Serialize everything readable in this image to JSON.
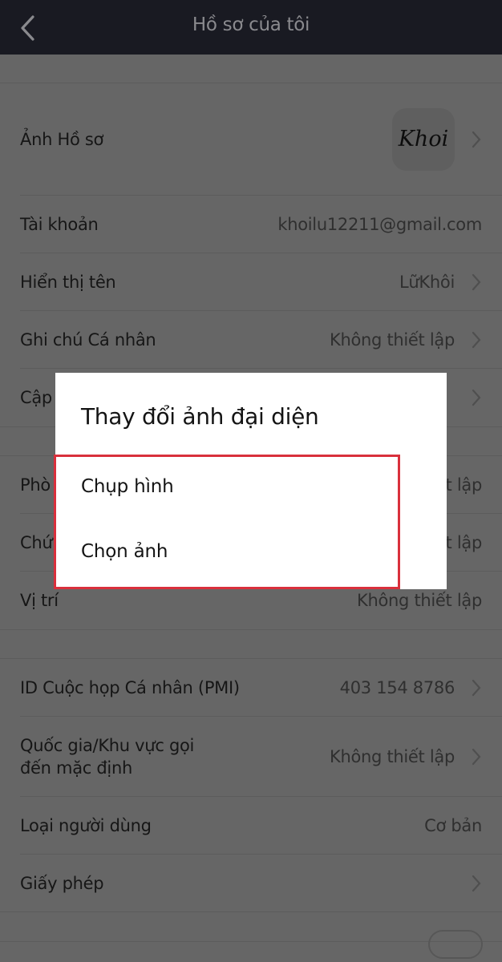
{
  "header": {
    "back_icon": "chevron-left-icon",
    "title": "Hồ sơ của tôi"
  },
  "sections": [
    {
      "rows": [
        {
          "label": "Ảnh Hồ sơ",
          "avatar_text": "Khoi",
          "chevron": true
        },
        {
          "label": "Tài khoản",
          "value": "khoilu12211@gmail.com",
          "chevron": false
        },
        {
          "label": "Hiển thị tên",
          "value": "LữKhôi",
          "chevron": true
        },
        {
          "label": "Ghi chú Cá nhân",
          "value": "Không thiết lập",
          "chevron": true
        },
        {
          "label": "Cập",
          "value": "",
          "chevron": true
        }
      ]
    },
    {
      "rows": [
        {
          "label": "Phò",
          "value": "t lập",
          "chevron": false
        },
        {
          "label": "Chứ",
          "value": "t lập",
          "chevron": false
        },
        {
          "label": "Vị trí",
          "value": "Không thiết lập",
          "chevron": false
        }
      ]
    },
    {
      "rows": [
        {
          "label": "ID Cuộc họp Cá nhân (PMI)",
          "value": "403 154 8786",
          "chevron": true
        },
        {
          "label_line1": "Quốc gia/Khu vực gọi",
          "label_line2": "đến mặc định",
          "value": "Không thiết lập",
          "chevron": true
        },
        {
          "label": "Loại người dùng",
          "value": "Cơ bản",
          "chevron": false
        },
        {
          "label": "Giấy phép",
          "value": "",
          "chevron": true
        }
      ]
    }
  ],
  "dialog": {
    "title": "Thay đổi ảnh đại diện",
    "options": [
      "Chụp hình",
      "Chọn ảnh"
    ],
    "highlight_color": "#d9303c"
  },
  "colors": {
    "header_bg": "#191a22",
    "overlay_bg": "#666666",
    "dialog_bg": "#ffffff"
  }
}
